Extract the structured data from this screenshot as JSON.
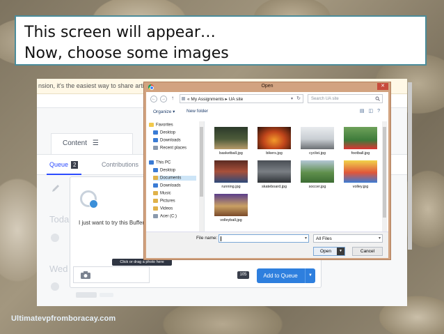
{
  "slide": {
    "title_line1": "This screen will appear…",
    "title_line2": "Now, choose some images",
    "footer_url": "Ultimatevpfromboracay.com"
  },
  "app": {
    "banner_text": "nsion, it's the easiest way to share articles",
    "content_tab": "Content",
    "queue_tab": "Queue",
    "queue_count": "2",
    "contributions_tab": "Contributions",
    "today_label": "Toda",
    "wed_label": "Wed",
    "composer_text": "I just want to try this Buffer",
    "photo_tooltip": "Click or drag a photo here",
    "char_count": "105",
    "add_to_queue": "Add to Queue"
  },
  "dialog": {
    "title": "Open",
    "close_glyph": "✕",
    "breadcrumb": "« My Assignments ▸ UA site",
    "search_placeholder": "Search UA site",
    "organize": "Organize ▾",
    "new_folder": "New folder",
    "nav_items": [
      {
        "label": "Favorites"
      },
      {
        "label": "Desktop"
      },
      {
        "label": "Downloads"
      },
      {
        "label": "Recent places"
      },
      {
        "label": "This PC"
      },
      {
        "label": "Desktop"
      },
      {
        "label": "Documents"
      },
      {
        "label": "Downloads"
      },
      {
        "label": "Music"
      },
      {
        "label": "Pictures"
      },
      {
        "label": "Videos"
      },
      {
        "label": "Acer (C:)"
      }
    ],
    "files": [
      {
        "name": "basketball.jpg"
      },
      {
        "name": "bikers.jpg"
      },
      {
        "name": "cyclist.jpg"
      },
      {
        "name": "football.jpg"
      },
      {
        "name": "running.jpg"
      },
      {
        "name": "skateboard.jpg"
      },
      {
        "name": "soccer.jpg"
      },
      {
        "name": "volley.jpg"
      },
      {
        "name": "volleyball.jpg"
      }
    ],
    "file_name_label": "File name:",
    "file_name_value": "",
    "file_type": "All Files",
    "open_button": "Open",
    "cancel_button": "Cancel"
  }
}
